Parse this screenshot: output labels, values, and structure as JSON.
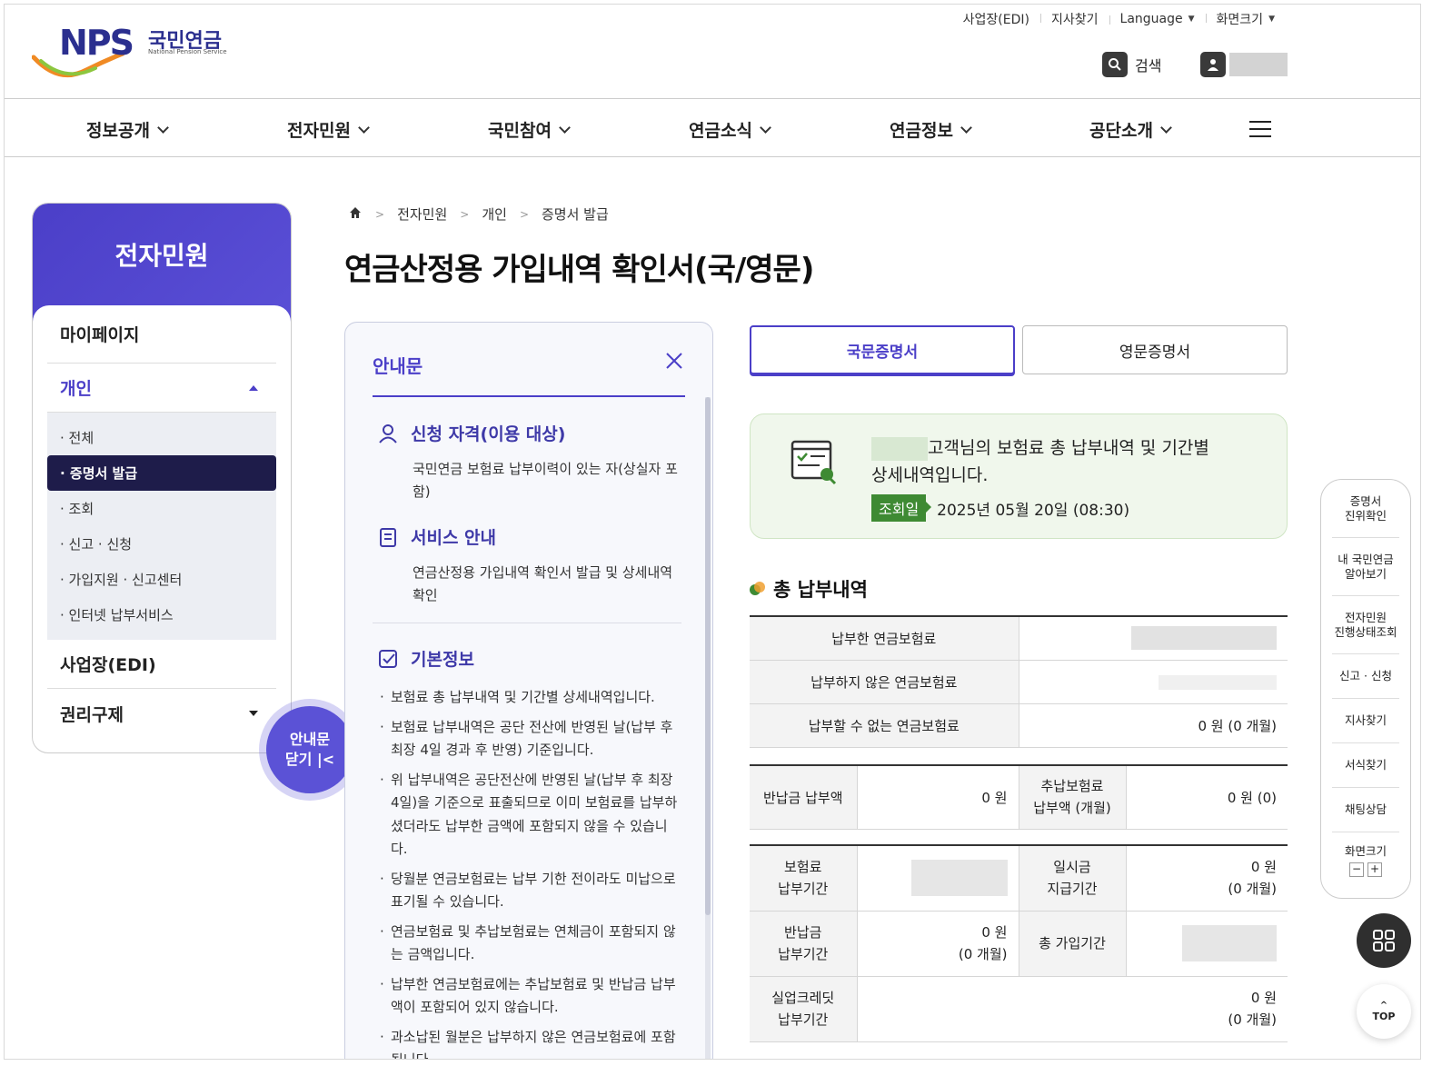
{
  "brand": {
    "logo_text": "NPS",
    "logo_korean": "국민연금",
    "logo_english": "National Pension Service",
    "primary_color": "#4b3fc8",
    "accent_green": "#3e8a33"
  },
  "utility_links": [
    {
      "label": "사업장(EDI)"
    },
    {
      "label": "지사찾기"
    },
    {
      "label": "Language",
      "icon": "caret-down-icon"
    },
    {
      "label": "화면크기",
      "icon": "caret-down-icon"
    }
  ],
  "header": {
    "search_label": "검색",
    "search_icon": "search-icon",
    "user_icon": "user-icon"
  },
  "gnb": [
    {
      "label": "정보공개"
    },
    {
      "label": "전자민원"
    },
    {
      "label": "국민참여"
    },
    {
      "label": "연금소식"
    },
    {
      "label": "연금정보"
    },
    {
      "label": "공단소개"
    }
  ],
  "lnb": {
    "title": "전자민원",
    "items": [
      {
        "label": "마이페이지"
      },
      {
        "label": "개인",
        "expanded": true
      },
      {
        "label": "사업장(EDI)"
      },
      {
        "label": "권리구제"
      }
    ],
    "sub_items": [
      {
        "label": "· 전체"
      },
      {
        "label": "· 증명서 발급",
        "active": true
      },
      {
        "label": "· 조회"
      },
      {
        "label": "· 신고 · 신청"
      },
      {
        "label": "· 가입지원 · 신고센터"
      },
      {
        "label": "· 인터넷 납부서비스"
      }
    ],
    "guide_toggle_line1": "안내문",
    "guide_toggle_line2": "닫기 |<"
  },
  "breadcrumb": {
    "items": [
      "전자민원",
      "개인",
      "증명서 발급"
    ],
    "sep": ">"
  },
  "page_title": "연금산정용 가입내역 확인서(국/영문)",
  "guide": {
    "title": "안내문",
    "sections": [
      {
        "icon": "person-icon",
        "heading": "신청 자격(이용 대상)",
        "body": "국민연금 보험료 납부이력이 있는 자(상실자 포함)"
      },
      {
        "icon": "document-icon",
        "heading": "서비스 안내",
        "body": "연금산정용 가입내역 확인서 발급 및 상세내역 확인"
      },
      {
        "icon": "checkbox-icon",
        "heading": "기본정보"
      }
    ],
    "notes": [
      "보험료 총 납부내역 및 기간별 상세내역입니다.",
      "보험료 납부내역은 공단 전산에 반영된 날(납부 후 최장 4일 경과 후 반영) 기준입니다.",
      "위 납부내역은 공단전산에 반영된 날(납부 후 최장 4일)을 기준으로 표출되므로 이미 보험료를 납부하셨더라도 납부한 금액에 포함되지 않을 수 있습니다.",
      "당월분 연금보험료는 납부 기한 전이라도 미납으로 표기될 수 있습니다.",
      "연금보험료 및 추납보험료는 연체금이 포함되지 않는 금액입니다.",
      "납부한 연금보험료에는 추납보험료 및 반납금 납부액이 포함되어 있지 않습니다.",
      "과소납된 월분은 납부하지 않은 연금보험료에 포함됩니다."
    ]
  },
  "tabs": [
    {
      "label": "국문증명서",
      "active": true
    },
    {
      "label": "영문증명서",
      "active": false
    }
  ],
  "info": {
    "message_line1": "고객님의 보험료 총 납부내역 및 기간별",
    "message_line2": "상세내역입니다.",
    "date_badge": "조회일",
    "date_value": "2025년 05월 20일 (08:30)"
  },
  "section_title": "총 납부내역",
  "table1": [
    {
      "label": "납부한 연금보험료",
      "value": ""
    },
    {
      "label": "납부하지 않은 연금보험료",
      "value": ""
    },
    {
      "label": "납부할 수 없는 연금보험료",
      "value": "0 원 (0 개월)"
    }
  ],
  "table2": {
    "label1": "반납금 납부액",
    "value1": "0 원",
    "label2_a": "추납보험료",
    "label2_b": "납부액 (개월)",
    "value2": "0 원 (0)"
  },
  "table3": {
    "r1": {
      "label_a": "보험료",
      "label_b": "납부기간",
      "value": "",
      "label2_a": "일시금",
      "label2_b": "지급기간",
      "value2_a": "0 원",
      "value2_b": "(0 개월)"
    },
    "r2": {
      "label_a": "반납금",
      "label_b": "납부기간",
      "value_a": "0 원",
      "value_b": "(0 개월)",
      "label2": "총 가입기간",
      "value2": ""
    },
    "r3": {
      "label_a": "실업크레딧",
      "label_b": "납부기간",
      "value_a": "0 원",
      "value_b": "(0 개월)"
    }
  },
  "quick_menu": [
    {
      "line1": "증명서",
      "line2": "진위확인"
    },
    {
      "line1": "내 국민연금",
      "line2": "알아보기"
    },
    {
      "line1": "전자민원",
      "line2": "진행상태조회"
    },
    {
      "line1": "신고 · 신청",
      "line2": ""
    },
    {
      "line1": "지사찾기",
      "line2": ""
    },
    {
      "line1": "서식찾기",
      "line2": ""
    },
    {
      "line1": "채팅상담",
      "line2": ""
    }
  ],
  "quick_zoom": {
    "label": "화면크기",
    "minus": "−",
    "plus": "+"
  },
  "top_button": "TOP"
}
